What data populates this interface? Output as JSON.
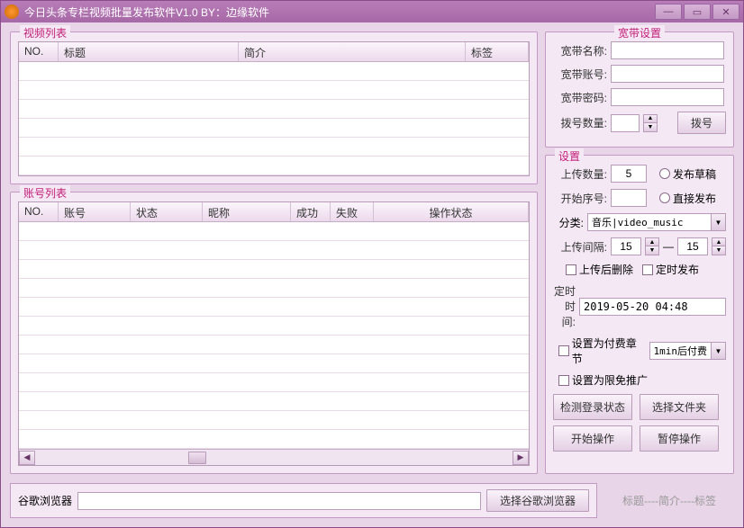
{
  "window": {
    "title": "今日头条专栏视频批量发布软件V1.0 BY：边缘软件"
  },
  "video_list": {
    "title": "视频列表",
    "columns": {
      "no": "NO.",
      "title": "标题",
      "intro": "简介",
      "tag": "标签"
    }
  },
  "account_list": {
    "title": "账号列表",
    "columns": {
      "no": "NO.",
      "account": "账号",
      "status": "状态",
      "nickname": "昵称",
      "success": "成功",
      "fail": "失败",
      "op_status": "操作状态"
    }
  },
  "broadband": {
    "title": "宽带设置",
    "name_label": "宽带名称:",
    "acct_label": "宽带账号:",
    "pwd_label": "宽带密码:",
    "dial_count_label": "拨号数量:",
    "dial_btn": "拨号"
  },
  "settings": {
    "title": "设置",
    "upload_count_label": "上传数量:",
    "upload_count_value": "5",
    "draft_radio": "发布草稿",
    "start_seq_label": "开始序号:",
    "direct_radio": "直接发布",
    "category_label": "分类:",
    "category_value": "音乐|video_music",
    "interval_label": "上传间隔:",
    "interval_from": "15",
    "interval_to": "15",
    "interval_sep": "—",
    "delete_after": "上传后删除",
    "schedule_publish": "定时发布",
    "schedule_time_label": "定时时间:",
    "schedule_time_value": "2019-05-20 04:48",
    "paid_chapter": "设置为付费章节",
    "paid_after_value": "1min后付费",
    "free_promo": "设置为限免推广",
    "btn_check_login": "检测登录状态",
    "btn_select_folder": "选择文件夹",
    "btn_start": "开始操作",
    "btn_pause": "暂停操作"
  },
  "bottom": {
    "browser_label": "谷歌浏览器",
    "select_browser_btn": "选择谷歌浏览器",
    "placeholder": "标题----简介----标签"
  }
}
